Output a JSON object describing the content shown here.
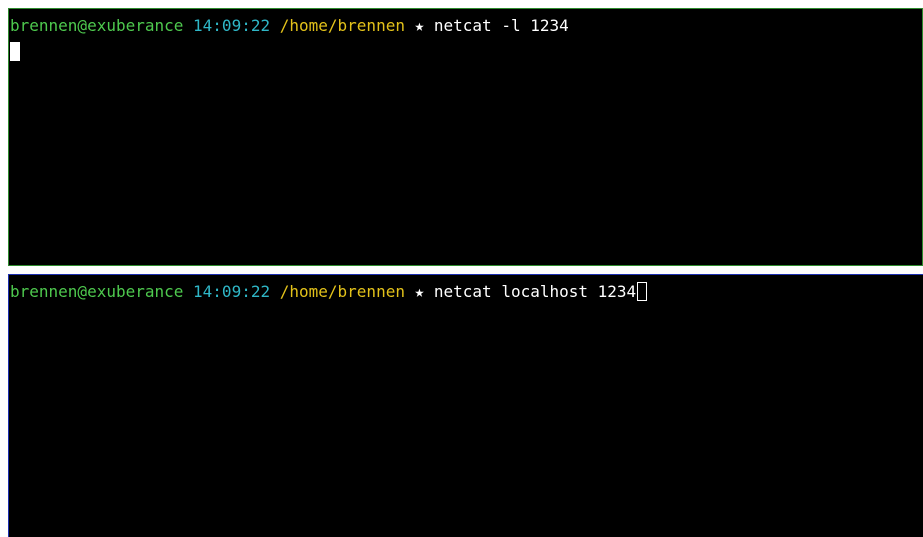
{
  "panes": [
    {
      "prompt": {
        "user_host": "brennen@exuberance",
        "time": "14:09:22",
        "path": "/home/brennen",
        "separator": "★",
        "command": "netcat -l 1234"
      },
      "border_color": "#2e8b2e",
      "cursor": "block"
    },
    {
      "prompt": {
        "user_host": "brennen@exuberance",
        "time": "14:09:22",
        "path": "/home/brennen",
        "separator": "★",
        "command": "netcat localhost 1234"
      },
      "border_color": "#1c2fb0",
      "cursor": "outline"
    }
  ],
  "colors": {
    "background": "#000000",
    "user_host": "#4ec94e",
    "time": "#2fb7c7",
    "path": "#e3c21a",
    "text": "#ffffff"
  }
}
